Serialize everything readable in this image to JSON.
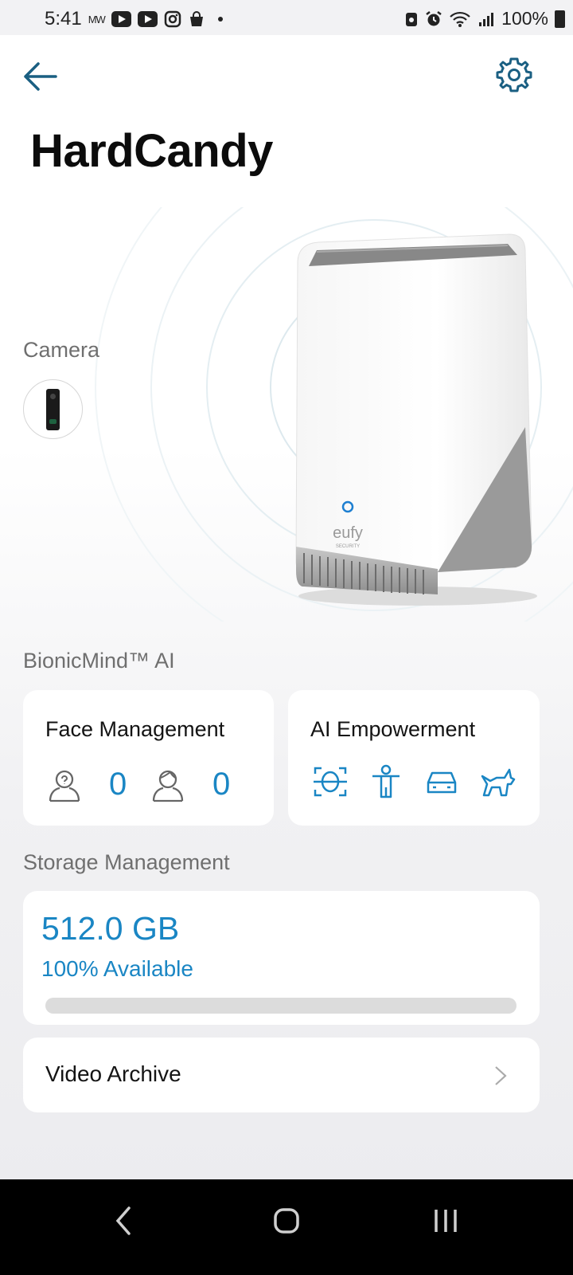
{
  "status_bar": {
    "time": "5:41",
    "small_text": "MW",
    "battery": "100%"
  },
  "header": {
    "title": "HardCandy",
    "back_icon": "arrow-left-icon",
    "settings_icon": "gear-icon"
  },
  "hero": {
    "camera_label": "Camera",
    "device_brand": "eufy",
    "device_brand_sub": "SECURITY"
  },
  "ai_section": {
    "label": "BionicMind™ AI",
    "face_card": {
      "title": "Face Management",
      "known_count": "0",
      "stranger_count": "0"
    },
    "ai_card": {
      "title": "AI Empowerment",
      "icons": [
        "face-detect-icon",
        "human-icon",
        "vehicle-icon",
        "pet-icon"
      ]
    }
  },
  "storage_section": {
    "label": "Storage Management",
    "size": "512.0 GB",
    "available": "100% Available",
    "used_fraction": 0
  },
  "archive": {
    "label": "Video Archive"
  },
  "colors": {
    "accent": "#1a86c4",
    "title": "#0c0c0c",
    "muted": "#6f6f6f",
    "icon_teal": "#1a5f82"
  }
}
